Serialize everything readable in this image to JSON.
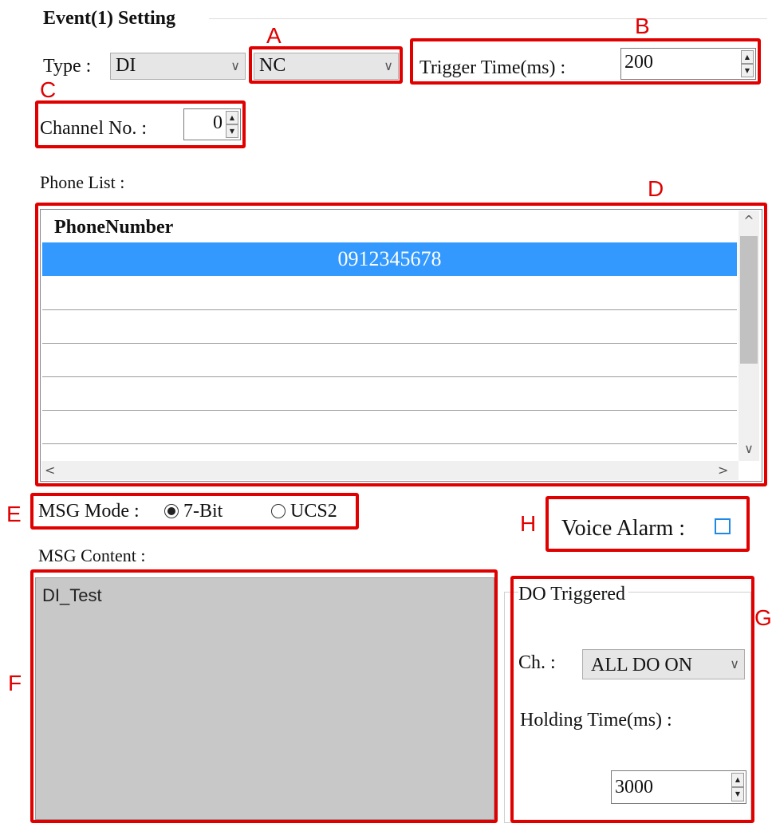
{
  "event": {
    "title": "Event(1) Setting",
    "type_label": "Type :",
    "type_value": "DI",
    "contact_value": "NC",
    "trigger_time_label": "Trigger Time(ms) :",
    "trigger_time_value": "200",
    "channel_label": "Channel No. :",
    "channel_value": "0"
  },
  "phone_list": {
    "label": "Phone List :",
    "column_header": "PhoneNumber",
    "rows": [
      "0912345678",
      "",
      "",
      "",
      "",
      ""
    ]
  },
  "msg": {
    "mode_label": "MSG Mode :",
    "mode_options": [
      "7-Bit",
      "UCS2"
    ],
    "mode_selected": "7-Bit",
    "content_label": "MSG Content :",
    "content_value": "DI_Test"
  },
  "voice_alarm": {
    "label": "Voice Alarm :",
    "checked": false
  },
  "do_triggered": {
    "group_title": "DO Triggered",
    "ch_label": "Ch. :",
    "ch_value": "ALL DO ON",
    "holding_label": "Holding Time(ms) :",
    "holding_value": "3000"
  },
  "annotations": [
    "A",
    "B",
    "C",
    "D",
    "E",
    "F",
    "G",
    "H"
  ],
  "colors": {
    "highlight_annotation": "#e00000",
    "selected_row": "#3399ff",
    "readonly_bg": "#c8c8c8",
    "combo_bg": "#e6e6e6"
  },
  "icons": {
    "dropdown": "chevron-down-icon",
    "spin_up": "spin-up-icon",
    "spin_down": "spin-down-icon",
    "scroll_up": "chevron-up-icon",
    "scroll_down": "chevron-down-icon",
    "scroll_left": "chevron-left-icon",
    "scroll_right": "chevron-right-icon"
  }
}
